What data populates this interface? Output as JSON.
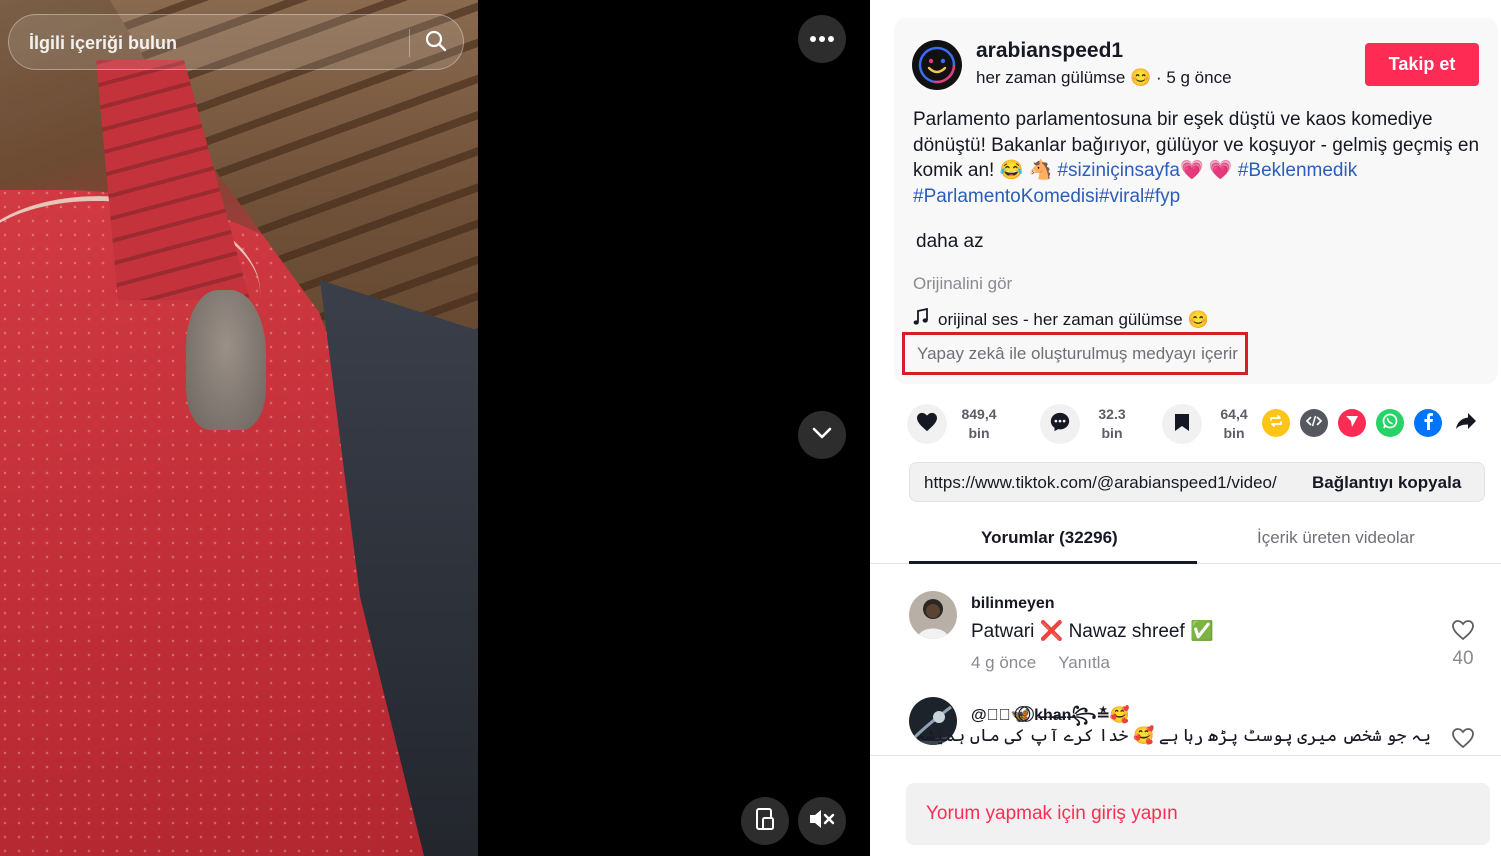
{
  "search": {
    "placeholder": "İlgili içeriği bulun"
  },
  "video_controls": {
    "more_icon": "more-horizontal-icon",
    "next_icon": "chevron-down-icon",
    "pip_icon": "picture-in-picture-icon",
    "mute_icon": "volume-muted-icon"
  },
  "author": {
    "username": "arabianspeed1",
    "display_name": "her zaman gülümse 😊",
    "posted": "· 5 g önce",
    "follow_label": "Takip et"
  },
  "description": {
    "text_before": "Parlamento parlamentosuna bir eşek düştü ve kaos komediye dönüştü! Bakanlar bağırıyor, gülüyor ve koşuyor - gelmiş geçmiş en komik an! 😂 🐴 ",
    "tag1": "#siziniçinsayfa",
    "hearts": "💗 💗 ",
    "tag2": "#Beklenmedik",
    "tag3": "#ParlamentoKomedisi",
    "tag4": "#viral",
    "tag5": "#fyp",
    "less_label": "daha az",
    "see_original": "Orijinalini gör",
    "music": "orijinal ses - her zaman gülümse 😊",
    "ai_label": "Yapay zekâ ile oluşturulmuş medyayı içerir"
  },
  "actions": {
    "likes_top": "849,4",
    "likes_unit": "bin",
    "comments_top": "32.3",
    "comments_unit": "bin",
    "saves_top": "64,4",
    "saves_unit": "bin"
  },
  "share_icons": [
    "repost-icon",
    "embed-icon",
    "send-icon",
    "whatsapp-icon",
    "facebook-icon",
    "share-arrow-icon"
  ],
  "colors": {
    "accent": "#fe2c55",
    "hashtag": "#2b5db9",
    "ai_border": "#d41f2a"
  },
  "link": {
    "url": "https://www.tiktok.com/@arabianspeed1/video/",
    "copy_label": "Bağlantıyı kopyala"
  },
  "tabs": {
    "comments": "Yorumlar (32296)",
    "creator_videos": "İçerik üreten videolar"
  },
  "comments": [
    {
      "user": "bilinmeyen",
      "text": "Patwari ❌ Nawaz shreef ✅",
      "time": "4 g önce",
      "reply": "Yanıtla",
      "likes": "40"
    },
    {
      "user": "@꧁⃝🦋⃝ ⃝k̶h̶a̶n̶꧂≛🥰",
      "text": "یہ جو شخص میری پوسٹ پڑھ رہا ہے 🥰 خدا کرے آپ کی ماں ہمیشہ",
      "time": "",
      "reply": "",
      "likes": ""
    }
  ],
  "login": {
    "label": "Yorum yapmak için giriş yapın"
  }
}
